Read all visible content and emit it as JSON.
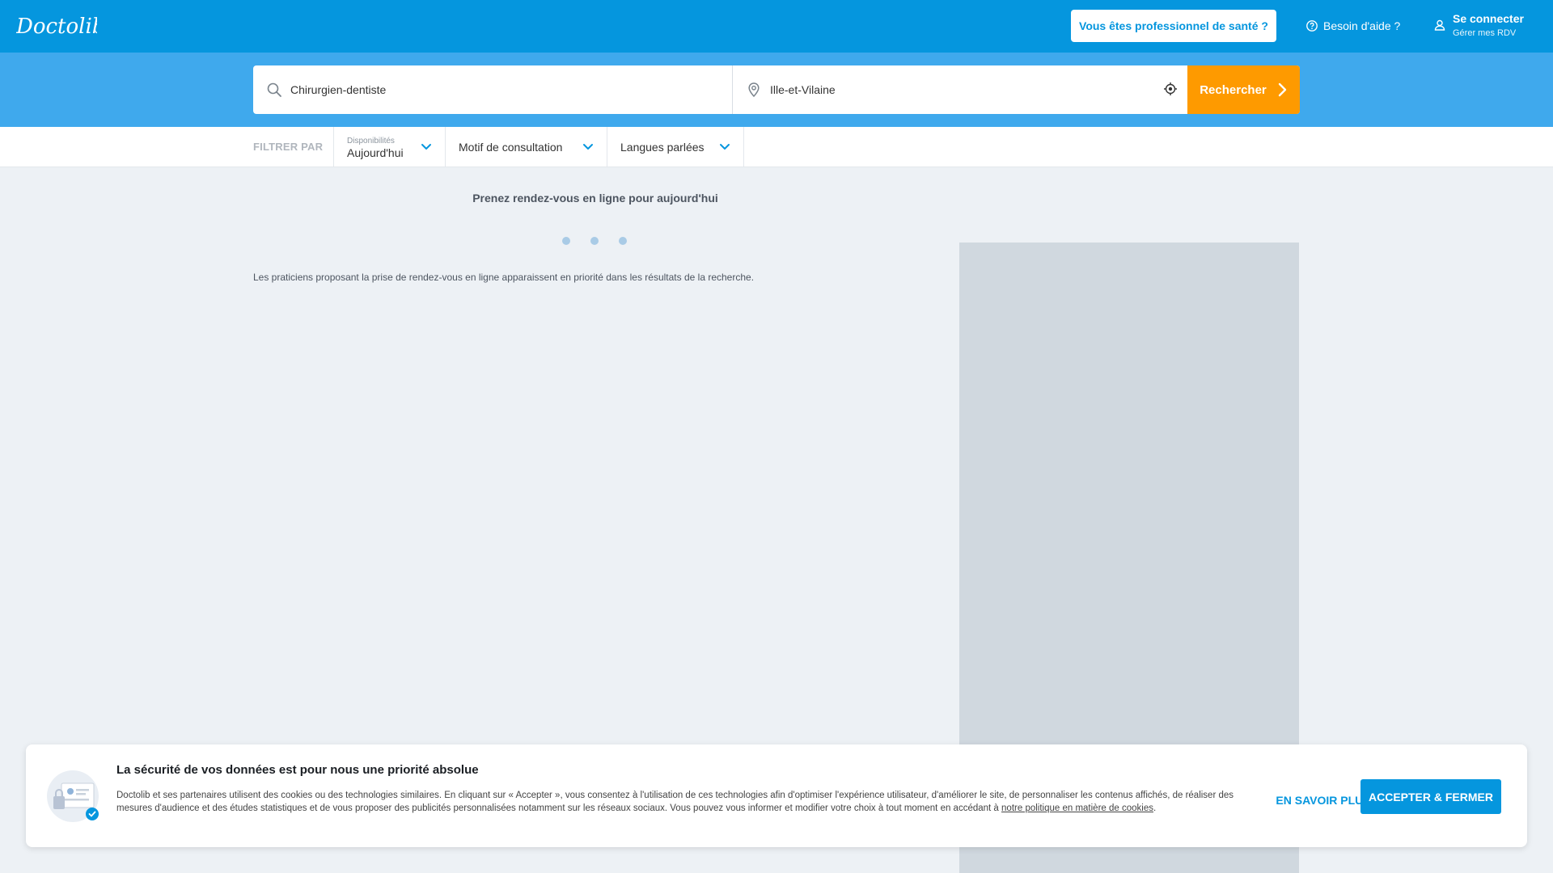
{
  "header": {
    "logo_text": "Doctolib",
    "pro_button": "Vous êtes professionnel de santé ?",
    "help_label": "Besoin d'aide ?",
    "login_label": "Se connecter",
    "login_sub": "Gérer mes RDV"
  },
  "search": {
    "specialty_value": "Chirurgien-dentiste",
    "location_value": "Ille-et-Vilaine",
    "button_label": "Rechercher"
  },
  "filters": {
    "label": "FILTRER PAR",
    "availability_caption": "Disponibilités",
    "availability_value": "Aujourd'hui",
    "reason_label": "Motif de consultation",
    "languages_label": "Langues parlées"
  },
  "content": {
    "headline": "Prenez rendez-vous en ligne pour aujourd'hui",
    "note": "Les praticiens proposant la prise de rendez-vous en ligne apparaissent en priorité dans les résultats de la recherche."
  },
  "cookie_banner": {
    "title": "La sécurité de vos données est pour nous une priorité absolue",
    "body": "Doctolib et ses partenaires utilisent des cookies ou des technologies similaires. En cliquant sur « Accepter », vous consentez à l'utilisation de ces technologies afin d'optimiser l'expérience utilisateur, d'améliorer le site, de personnaliser les contenus affichés, de réaliser des mesures d'audience et des études statistiques et de vous proposer des publicités personnalisées notamment sur les réseaux sociaux. Vous pouvez vous informer et modifier votre choix à tout moment en accédant à ",
    "link_text": "notre politique en matière de cookies",
    "body_end": ".",
    "more_button": "EN SAVOIR PLUS",
    "accept_button": "ACCEPTER & FERMER"
  },
  "colors": {
    "brand_blue": "#0596de",
    "search_band": "#3fa9ed",
    "cta_orange": "#fe9a00",
    "page_bg": "#edf1f5"
  },
  "icons": [
    "doctolib-logo",
    "help-circle-icon",
    "user-icon",
    "search-icon",
    "map-pin-icon",
    "locate-icon",
    "chevron-right-icon",
    "chevron-down-icon",
    "security-illustration"
  ]
}
